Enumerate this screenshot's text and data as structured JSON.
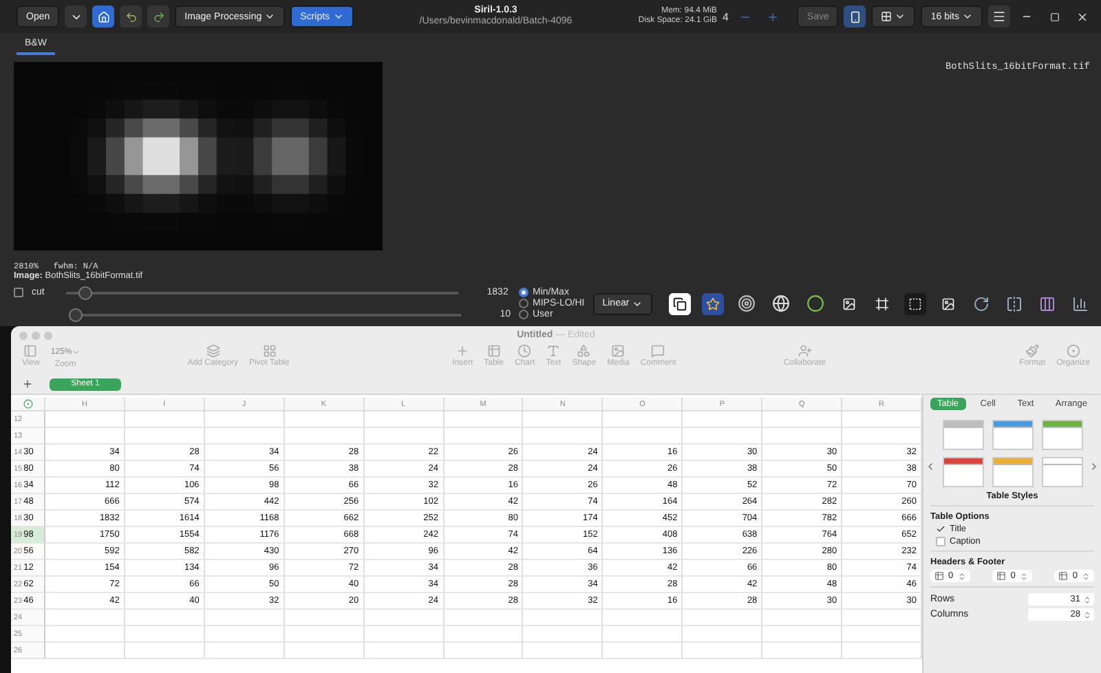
{
  "siril": {
    "toolbar": {
      "open": "Open",
      "image_processing": "Image Processing",
      "scripts": "Scripts",
      "title": "Siril-1.0.3",
      "path": "/Users/bevinmacdonald/Batch-4096",
      "mem": "Mem: 94.4 MiB",
      "disk": "Disk Space: 24.1 GiB",
      "count": "4",
      "save": "Save",
      "bits": "16 bits"
    },
    "tabs": [
      {
        "label": "B&W",
        "selected": true
      }
    ],
    "filename": "BothSlits_16bitFormat.tif",
    "zoom_status": "2810%   fwhm: N/A",
    "image_label": "**Image:** BothSlits_16bitFormat.tif",
    "cut": {
      "label": "cut",
      "checked": false
    },
    "sliders": [
      {
        "level": 0.03,
        "reading": "1832"
      },
      {
        "level": 0.0,
        "reading": "10"
      }
    ],
    "scale_modes": [
      {
        "label": "Min/Max",
        "selected": true
      },
      {
        "label": "MIPS-LO/HI",
        "selected": false
      },
      {
        "label": "User",
        "selected": false
      }
    ],
    "stretch": "Linear"
  },
  "numbers": {
    "title": "Untitled",
    "title_status": "— Edited",
    "toolbar": [
      {
        "kind": "view",
        "label": "View"
      },
      {
        "kind": "zoom",
        "label": "Zoom",
        "value": "125%"
      },
      {
        "kind": "category",
        "label": "Add Category"
      },
      {
        "kind": "pivot",
        "label": "Pivot Table"
      },
      {
        "kind": "insert",
        "label": "Insert"
      },
      {
        "kind": "table",
        "label": "Table"
      },
      {
        "kind": "chart",
        "label": "Chart"
      },
      {
        "kind": "text",
        "label": "Text"
      },
      {
        "kind": "shape",
        "label": "Shape"
      },
      {
        "kind": "media",
        "label": "Media"
      },
      {
        "kind": "comment",
        "label": "Comment"
      },
      {
        "kind": "collaborate",
        "label": "Collaborate"
      },
      {
        "kind": "format",
        "label": "Format"
      },
      {
        "kind": "organize",
        "label": "Organize"
      }
    ],
    "sheets": [
      {
        "label": "Sheet 1",
        "selected": true
      }
    ],
    "table": {
      "columns": [
        "H",
        "I",
        "J",
        "K",
        "L",
        "M",
        "N",
        "O",
        "P",
        "Q",
        "R"
      ],
      "rows": [
        {
          "number": "12",
          "selected": false,
          "cells": []
        },
        {
          "number": "13",
          "selected": false,
          "cells": []
        },
        {
          "number": "14",
          "selected": false,
          "column_g": "30",
          "cells": [
            "34",
            "28",
            "34",
            "28",
            "22",
            "26",
            "24",
            "16",
            "30",
            "30",
            "32"
          ]
        },
        {
          "number": "15",
          "selected": false,
          "column_g": "80",
          "cells": [
            "80",
            "74",
            "56",
            "38",
            "24",
            "28",
            "24",
            "26",
            "38",
            "50",
            "38"
          ]
        },
        {
          "number": "16",
          "selected": false,
          "column_g": "34",
          "cells": [
            "112",
            "106",
            "98",
            "66",
            "32",
            "16",
            "26",
            "48",
            "52",
            "72",
            "70"
          ]
        },
        {
          "number": "17",
          "selected": false,
          "column_g": "48",
          "cells": [
            "666",
            "574",
            "442",
            "256",
            "102",
            "42",
            "74",
            "164",
            "264",
            "282",
            "260"
          ]
        },
        {
          "number": "18",
          "selected": false,
          "column_g": "30",
          "cells": [
            "1832",
            "1614",
            "1168",
            "662",
            "252",
            "80",
            "174",
            "452",
            "704",
            "782",
            "666"
          ]
        },
        {
          "number": "19",
          "selected": true,
          "column_g": "98",
          "cells": [
            "1750",
            "1554",
            "1176",
            "668",
            "242",
            "74",
            "152",
            "408",
            "638",
            "764",
            "652"
          ]
        },
        {
          "number": "20",
          "selected": false,
          "column_g": "56",
          "cells": [
            "592",
            "582",
            "430",
            "270",
            "96",
            "42",
            "64",
            "136",
            "226",
            "280",
            "232"
          ]
        },
        {
          "number": "21",
          "selected": false,
          "column_g": "12",
          "cells": [
            "154",
            "134",
            "96",
            "72",
            "34",
            "28",
            "36",
            "42",
            "66",
            "80",
            "74"
          ]
        },
        {
          "number": "22",
          "selected": false,
          "column_g": "62",
          "cells": [
            "72",
            "66",
            "50",
            "40",
            "34",
            "28",
            "34",
            "28",
            "42",
            "48",
            "46"
          ]
        },
        {
          "number": "23",
          "selected": false,
          "column_g": "46",
          "cells": [
            "42",
            "40",
            "32",
            "20",
            "24",
            "28",
            "32",
            "16",
            "28",
            "30",
            "30"
          ]
        },
        {
          "number": "24",
          "selected": false,
          "cells": []
        },
        {
          "number": "25",
          "selected": false,
          "cells": []
        },
        {
          "number": "26",
          "selected": false,
          "cells": []
        }
      ]
    },
    "panel": {
      "tabs": [
        {
          "label": "Table",
          "selected": true
        },
        {
          "label": "Cell",
          "selected": false
        },
        {
          "label": "Text",
          "selected": false
        },
        {
          "label": "Arrange",
          "selected": false
        }
      ],
      "table_styles": [
        {
          "color": "#bdbdbd"
        },
        {
          "color": "#4a9be0"
        },
        {
          "color": "#6cb33f"
        },
        {
          "color": "#d9453b"
        },
        {
          "color": "#efad35"
        },
        {
          "color": "#ffffff"
        }
      ],
      "styles_label": "Table Styles",
      "options_label": "Table Options",
      "options": [
        {
          "label": "Title",
          "checked": true
        },
        {
          "label": "Caption",
          "checked": false
        }
      ],
      "headers_label": "Headers & Footer",
      "header_steppers": [
        "0",
        "0",
        "0"
      ],
      "rows_label": "Rows",
      "rows": "31",
      "columns_label": "Columns",
      "columns": "28"
    }
  }
}
